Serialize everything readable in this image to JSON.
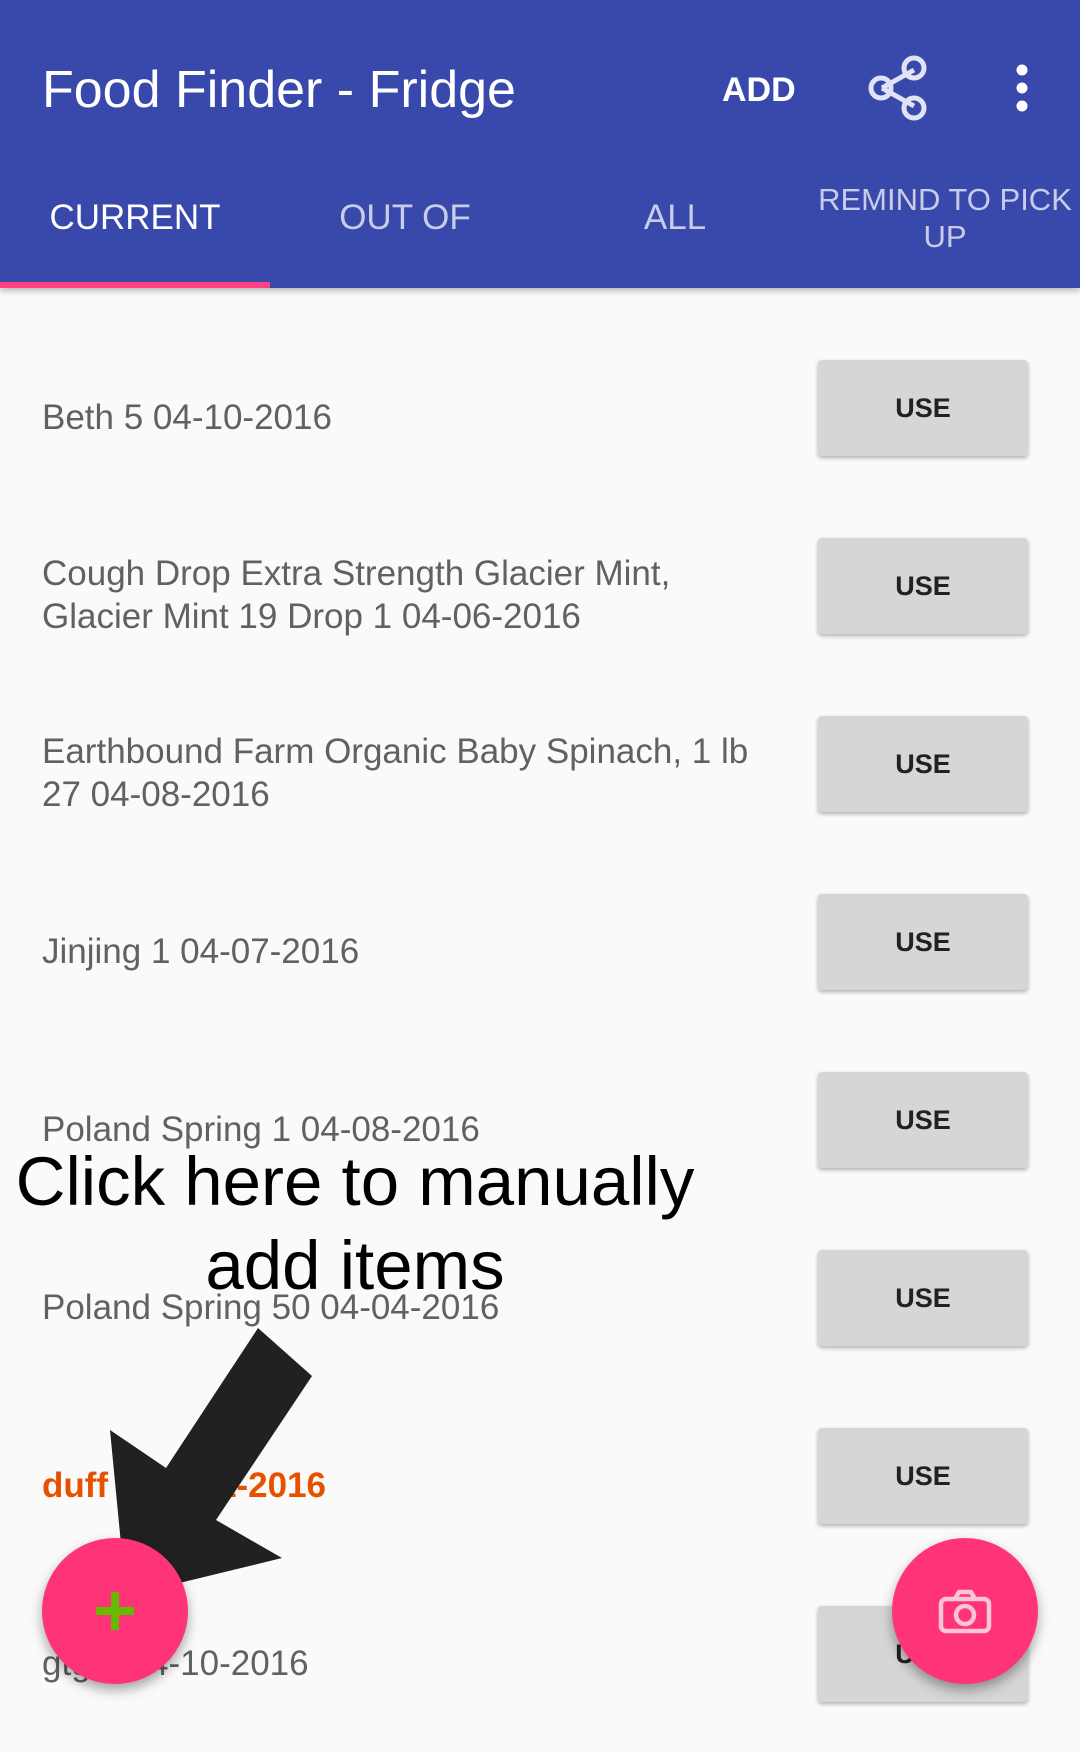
{
  "appbar": {
    "title": "Food Finder - Fridge",
    "add_label": "ADD",
    "share_icon": "share-icon",
    "overflow_icon": "more-vert-icon"
  },
  "tabs": [
    {
      "label": "CURRENT",
      "active": true
    },
    {
      "label": "OUT OF",
      "active": false
    },
    {
      "label": "ALL",
      "active": false
    },
    {
      "label": "REMIND TO PICK UP",
      "active": false
    }
  ],
  "items": [
    {
      "text": "Beth 5  04-10-2016",
      "action": "USE"
    },
    {
      "text": "Cough Drop Extra Strength Glacier Mint, Glacier Mint 19 Drop 1  04-06-2016",
      "action": "USE"
    },
    {
      "text": "Earthbound Farm Organic Baby Spinach, 1 lb 27 04-08-2016",
      "action": "USE"
    },
    {
      "text": "Jinjing 1  04-07-2016",
      "action": "USE"
    },
    {
      "text": "Poland Spring 1  04-08-2016",
      "action": "USE"
    },
    {
      "text": "Poland Spring 50  04-04-2016",
      "action": "USE"
    },
    {
      "text": "duff 1  03-31-2016",
      "action": "USE",
      "expired": true
    },
    {
      "text": "gtg 1  04-10-2016",
      "action": "USE"
    }
  ],
  "overlay": {
    "callout_line1": "Click here to manually",
    "callout_line2": "add items"
  },
  "fab": {
    "add_icon": "plus-icon",
    "camera_icon": "camera-icon"
  },
  "colors": {
    "primary": "#3949ab",
    "accent": "#ff4081",
    "fab": "#ff3378",
    "expired_text": "#e65100",
    "plus": "#66bb00"
  }
}
